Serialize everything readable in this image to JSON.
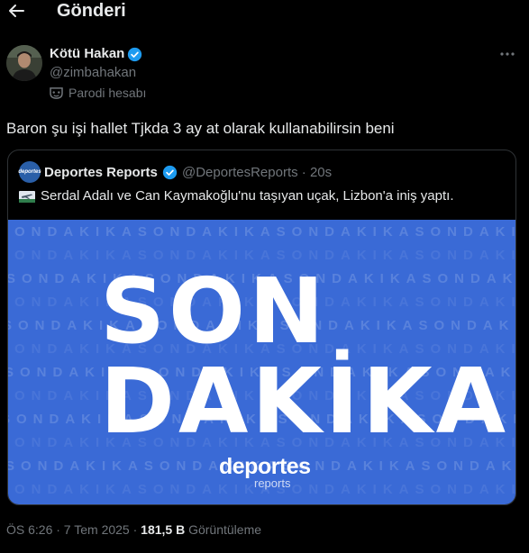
{
  "header": {
    "title": "Gönderi"
  },
  "author": {
    "name": "Kötü Hakan",
    "handle": "@zimbahakan",
    "parody_label": "Parodi hesabı",
    "verified_color": "#1d9bf0"
  },
  "tweet": {
    "text": "Baron şu işi hallet Tjkda 3 ay at olarak kullanabilirsin beni"
  },
  "quote": {
    "name": "Deportes Reports",
    "meta": "@DeportesReports · 20s",
    "text": "Serdal Adalı ve Can Kaymakoğlu'nu taşıyan uçak, Lizbon'a iniş yaptı.",
    "avatar_text": "deportes",
    "image": {
      "line1": "SON",
      "line2": "DAKİKA",
      "brand": "deportes",
      "brand_sub": "reports",
      "background_color": "#3a6ad6",
      "pattern_text": "SONDAKIKASONDAKIKASONDAKIKASONDAKIKASONDAKIKASONDAKIKA"
    }
  },
  "post_meta": {
    "time": "ÖS 6:26 · 7 Tem 2025 · ",
    "views_count": "181,5 B",
    "views_label": " Görüntüleme"
  }
}
